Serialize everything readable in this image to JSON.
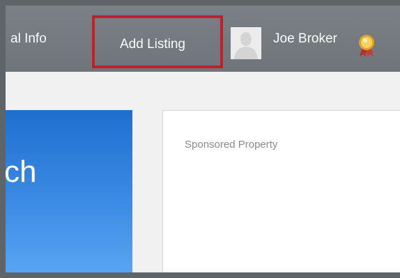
{
  "nav": {
    "local_info_label": "al Info",
    "add_listing_label": "Add Listing",
    "user_name": "Joe Broker"
  },
  "promo": {
    "text": "ch"
  },
  "sponsored": {
    "label": "Sponsored Property"
  },
  "colors": {
    "nav_background": "#72787d",
    "highlight_border": "#c0202a",
    "promo_blue": "#2f80e0",
    "frame": "#5f6468"
  },
  "icons": {
    "avatar": "user-avatar-placeholder",
    "award": "award-ribbon-icon"
  }
}
